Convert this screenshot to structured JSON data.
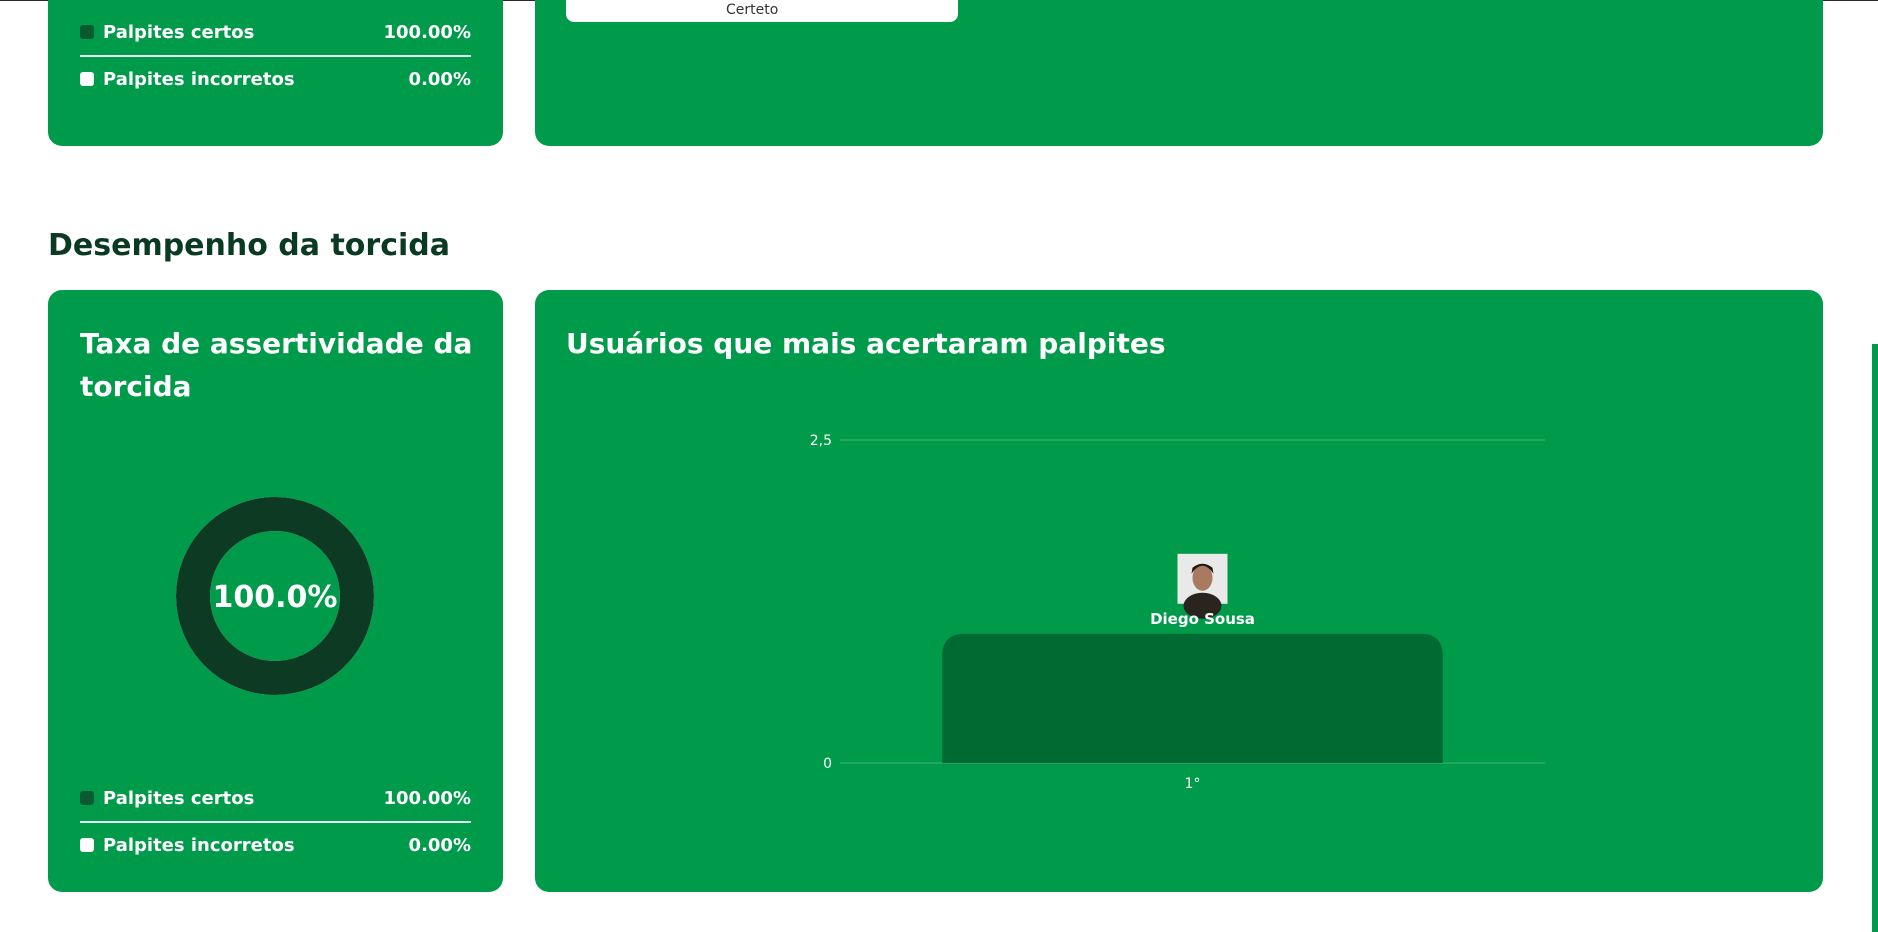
{
  "top_section": {
    "legend": {
      "correct_label": "Palpites certos",
      "correct_value": "100.00%",
      "incorrect_label": "Palpites incorretos",
      "incorrect_value": "0.00%"
    },
    "tab_label": "Certeto"
  },
  "section": {
    "heading": "Desempenho da torcida"
  },
  "accuracy_card": {
    "title": "Taxa de assertividade da torcida",
    "donut_label": "100.0%",
    "correct_ratio": 1.0,
    "legend": {
      "correct_label": "Palpites certos",
      "correct_value": "100.00%",
      "incorrect_label": "Palpites incorretos",
      "incorrect_value": "0.00%"
    }
  },
  "top_users_card": {
    "title": "Usuários que mais acertaram palpites"
  },
  "colors": {
    "card_green": "#009b4a",
    "dark_green": "#0d3a22",
    "bar_green": "#006a33",
    "legend_dark": "#0a5a31"
  },
  "chart_data": {
    "type": "bar",
    "categories": [
      "1°"
    ],
    "series": [
      {
        "values": [
          1
        ]
      }
    ],
    "bar_labels": [
      "Diego Sousa"
    ],
    "ylim": [
      0,
      2.5
    ],
    "y_ticks": [
      "0",
      "2,5"
    ],
    "grid": true
  }
}
